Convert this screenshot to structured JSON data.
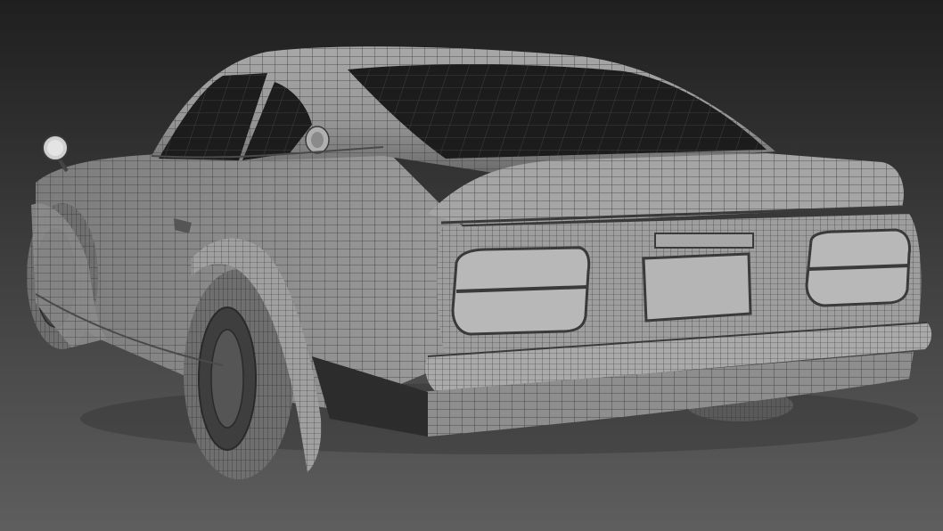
{
  "viewport": {
    "background_top": "#1f1f1f",
    "background_bottom": "#5e5e5e"
  },
  "model": {
    "body_color": "#9b9b9b",
    "body_shadow": "#5c5c5c",
    "wire_color": "#3a3a3a",
    "glass_color": "#1c1c1c",
    "tire_color": "#6f6f6f",
    "lens_color": "#b8b8b8"
  }
}
